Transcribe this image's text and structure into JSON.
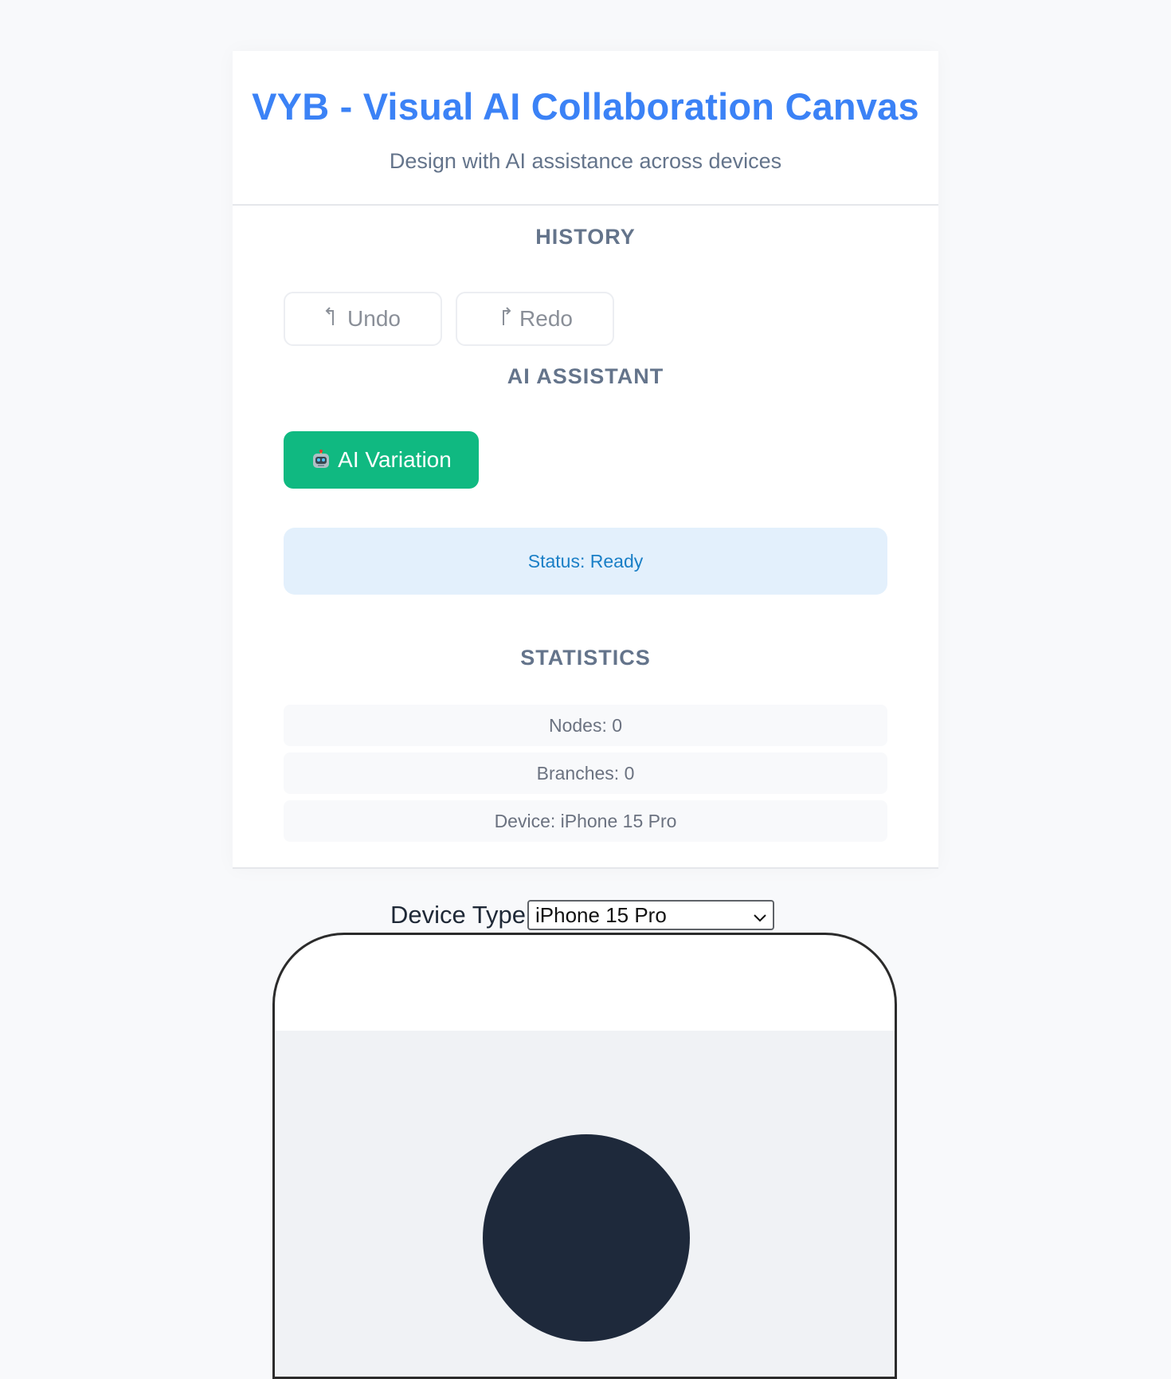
{
  "header": {
    "title": "VYB - Visual AI Collaboration Canvas",
    "subtitle": "Design with AI assistance across devices"
  },
  "history": {
    "heading": "HISTORY",
    "undo_label": "Undo",
    "undo_icon": "undo-arrow-icon",
    "redo_label": "Redo",
    "redo_icon": "redo-arrow-icon"
  },
  "ai_assistant": {
    "heading": "AI ASSISTANT",
    "variation_label": "AI Variation",
    "variation_icon": "robot-icon",
    "status_text": "Status: Ready"
  },
  "statistics": {
    "heading": "STATISTICS",
    "nodes": "Nodes: 0",
    "branches": "Branches: 0",
    "device": "Device: iPhone 15 Pro"
  },
  "device_picker": {
    "label": "Device Type",
    "selected": "iPhone 15 Pro"
  },
  "colors": {
    "accent": "#3b82f6",
    "ai_button": "#10b981",
    "status_bg": "#e3f0fc",
    "status_text": "#1a7fc6",
    "canvas_node": "#1e293b"
  }
}
